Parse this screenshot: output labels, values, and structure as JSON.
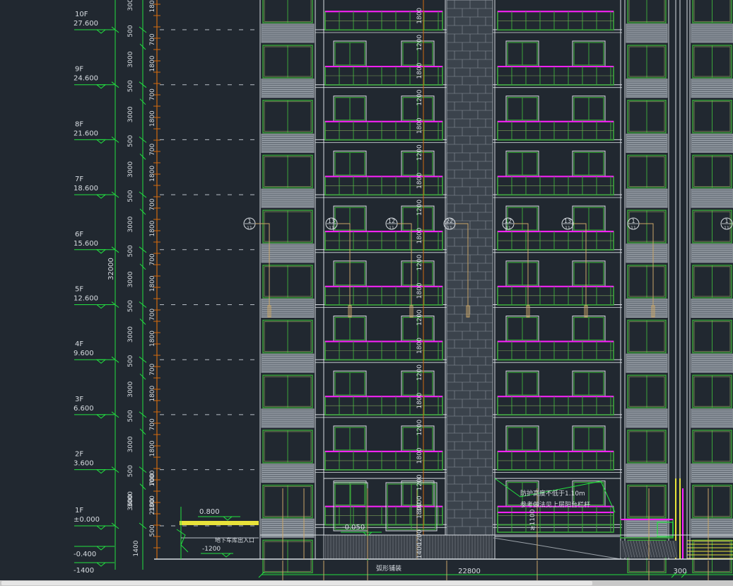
{
  "floors": [
    {
      "name": "10F",
      "elev": "27.600"
    },
    {
      "name": "9F",
      "elev": "24.600"
    },
    {
      "name": "8F",
      "elev": "21.600"
    },
    {
      "name": "7F",
      "elev": "18.600"
    },
    {
      "name": "6F",
      "elev": "15.600"
    },
    {
      "name": "5F",
      "elev": "12.600"
    },
    {
      "name": "4F",
      "elev": "9.600"
    },
    {
      "name": "3F",
      "elev": "6.600"
    },
    {
      "name": "2F",
      "elev": "3.600"
    },
    {
      "name": "1F",
      "elev": "±0.000"
    }
  ],
  "base_levels": [
    "-0.400",
    "-1400"
  ],
  "overall_height": "32000",
  "dims_upper": [
    "500",
    "3000",
    "700",
    "1800"
  ],
  "dims_ground": [
    "3600",
    "2100",
    "1000",
    "500",
    "1400"
  ],
  "bay_dims": [
    "1800",
    "1200"
  ],
  "ground_bay_dim": "3600",
  "ground_bottom_dim": "1400",
  "grid_tags": [
    "1",
    "13",
    "12",
    "22",
    "12",
    "13",
    "1",
    "1"
  ],
  "grid_tag_sub": "11",
  "annotations": {
    "left_level": "0.800",
    "garage_entrance": "地下车库出入口",
    "garage_level": "-1200",
    "ground_level": "-0.050",
    "railing_note_1": "防护高度不低于1.10m",
    "railing_note_2": "参考做法见上层阳台栏杆",
    "railing_dim": "≥1100",
    "paving_note": "弧形铺装"
  },
  "bottom_dims": [
    "22800",
    "300"
  ],
  "colors": {
    "background": "#212830",
    "dim_green": "#22e040",
    "white_line": "#d8dde2",
    "magenta": "#ff20ff",
    "window_green": "#3aa53a",
    "orange": "#d06a10",
    "yellow": "#e8e23a",
    "tan": "#c9a567"
  }
}
